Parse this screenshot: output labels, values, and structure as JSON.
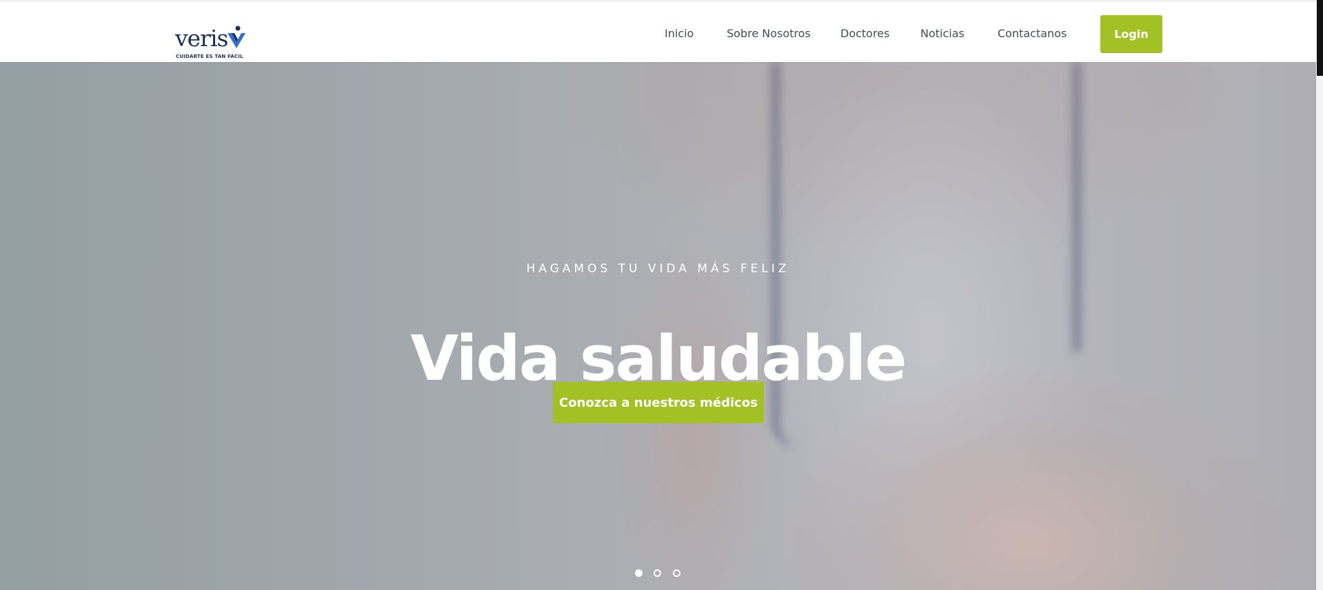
{
  "brand": {
    "name": "veris",
    "tagline": "CUIDARTE ES TAN FÁCIL",
    "logo_icon": "veris-v-mark-icon",
    "colors": {
      "navy": "#1b2f5b",
      "blue": "#2a6fd1"
    }
  },
  "nav": {
    "items": [
      {
        "label": "Inicio"
      },
      {
        "label": "Sobre Nosotros"
      },
      {
        "label": "Doctores"
      },
      {
        "label": "Noticias"
      },
      {
        "label": "Contactanos"
      }
    ],
    "login_label": "Login"
  },
  "hero": {
    "eyebrow": "HAGAMOS TU VIDA MÁS FELIZ",
    "title": "Vida saludable",
    "cta_label": "Conozca a nuestros médicos",
    "slides": {
      "count": 3,
      "active": 1
    }
  },
  "colors": {
    "accent": "#a3c024",
    "nav_text": "#444b55",
    "hero_text": "#ffffff"
  }
}
